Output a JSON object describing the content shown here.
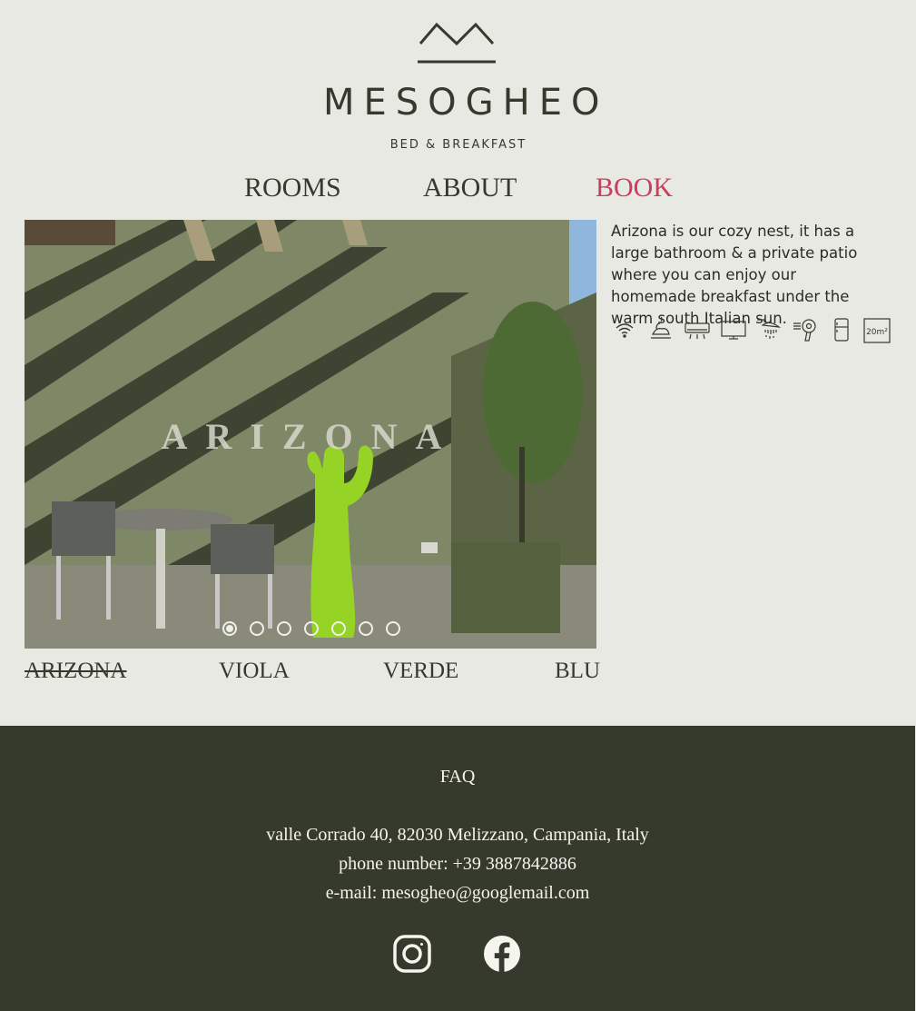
{
  "brand": {
    "name": "MESOGHEO",
    "subtitle": "BED & BREAKFAST"
  },
  "nav": {
    "rooms": "ROOMS",
    "about": "ABOUT",
    "book": "BOOK"
  },
  "slider": {
    "title": "ARIZONA",
    "slide_count": 7,
    "active_index": 0
  },
  "room_tabs": [
    "ARIZONA",
    "VIOLA",
    "VERDE",
    "BLU"
  ],
  "description": "Arizona is our cozy nest, it has a large bathroom & a private patio where you can enjoy our homemade breakfast under the warm south Italian sun.",
  "amenities": [
    {
      "icon": "wifi-icon"
    },
    {
      "icon": "breakfast-icon"
    },
    {
      "icon": "air-conditioning-icon"
    },
    {
      "icon": "tv-icon"
    },
    {
      "icon": "shower-icon"
    },
    {
      "icon": "hairdryer-icon"
    },
    {
      "icon": "fridge-icon"
    },
    {
      "icon": "room-size-icon",
      "label": "20m²"
    }
  ],
  "footer": {
    "faq": "FAQ",
    "address": "valle Corrado 40, 82030 Melizzano, Campania, Italy",
    "phone": "phone number: +39 3887842886",
    "email": "e-mail: mesogheo@googlemail.com"
  },
  "colors": {
    "background": "#e8e9e3",
    "text": "#363a2c",
    "accent": "#c93e5c",
    "footer": "#363a2c"
  }
}
